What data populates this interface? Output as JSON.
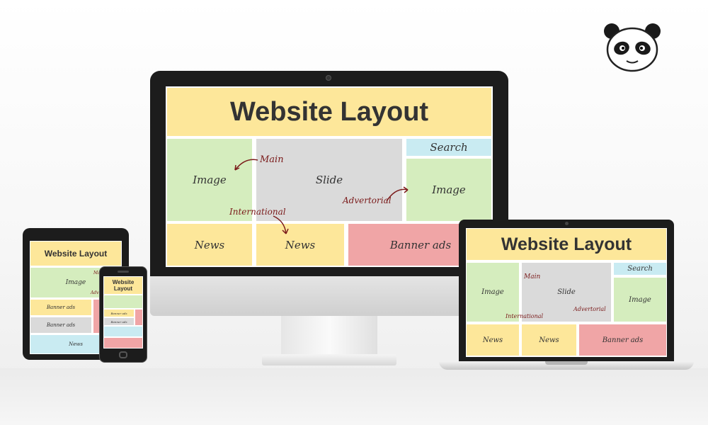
{
  "layout": {
    "title": "Website Layout",
    "search": "Search",
    "image": "Image",
    "slide": "Slide",
    "news": "News",
    "banner": "Banner ads",
    "main_note": "Main",
    "adv_note": "Advertorial",
    "intl_note": "International"
  },
  "colors": {
    "header": "#fde79a",
    "image_block": "#d5edbe",
    "slide_block": "#dadada",
    "search_block": "#c9ebf2",
    "banner_block": "#f0a5a6",
    "note_ink": "#7a1a1a"
  },
  "devices": [
    "desktop-monitor",
    "laptop",
    "tablet",
    "smartphone"
  ],
  "logo": "panda-icon"
}
